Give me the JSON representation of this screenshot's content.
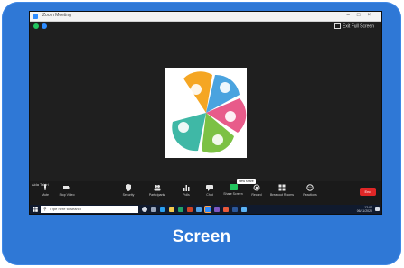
{
  "window": {
    "title": "Zoom Meeting"
  },
  "meeting": {
    "exit_fullscreen_label": "Exit Full Screen",
    "participant_name": "Aida Tahiri"
  },
  "toolbar": {
    "items": [
      {
        "label": "Mute",
        "icon": "microphone-icon"
      },
      {
        "label": "Stop Video",
        "icon": "video-camera-icon"
      },
      {
        "label": "Security",
        "icon": "shield-icon"
      },
      {
        "label": "Participants",
        "icon": "participants-icon",
        "count": "1"
      },
      {
        "label": "Polls",
        "icon": "polls-icon"
      },
      {
        "label": "Chat",
        "icon": "chat-icon"
      },
      {
        "label": "Share Screen",
        "icon": "share-screen-icon"
      },
      {
        "label": "Record",
        "icon": "record-icon"
      },
      {
        "label": "Breakout Rooms",
        "icon": "breakout-rooms-icon"
      },
      {
        "label": "Reactions",
        "icon": "reactions-icon"
      }
    ],
    "share_tooltip": "New share",
    "end_label": "End"
  },
  "taskbar": {
    "search_placeholder": "Type here to search",
    "time": "12:07",
    "date": "06/11/2020"
  },
  "caption": {
    "text": "Screen"
  },
  "colors": {
    "card": "#2f78d6",
    "zoom_blue": "#2d8cff",
    "end_red": "#e02727",
    "share_green": "#22c55e",
    "petal_orange": "#f5a623",
    "petal_blue": "#4aa3df",
    "petal_pink": "#e85b8a",
    "petal_green": "#7cc144",
    "petal_teal": "#3fb8a6"
  }
}
